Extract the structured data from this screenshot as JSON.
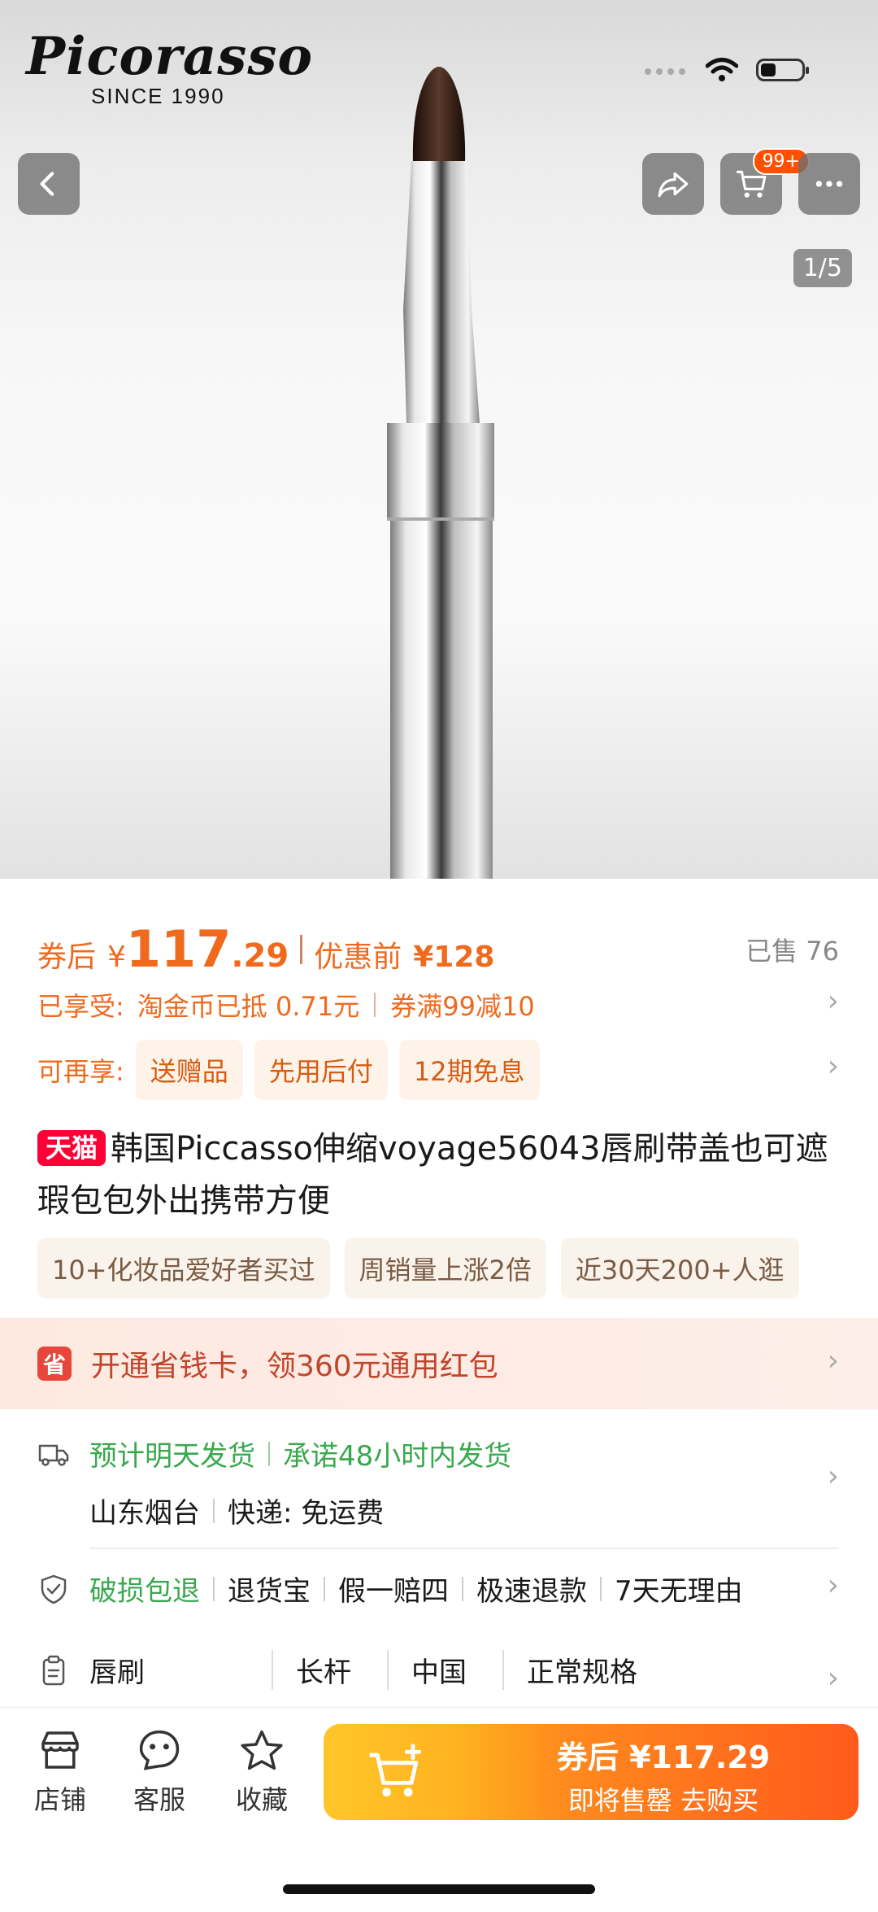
{
  "brand": {
    "logo_text": "Picorasso",
    "since": "SINCE 1990"
  },
  "nav": {
    "cart_badge": "99+",
    "image_counter": "1/5"
  },
  "price": {
    "coupon_label": "券后",
    "currency": "¥",
    "coupon_price_int": "117",
    "coupon_price_dec": ".29",
    "original_label": "优惠前",
    "original_price": "¥128",
    "sold": "已售 76"
  },
  "discounts": {
    "label": "已享受:",
    "item1": "淘金币已抵 0.71元",
    "item2": "券满99减10"
  },
  "extras": {
    "label": "可再享:",
    "chips": [
      "送赠品",
      "先用后付",
      "12期免息"
    ]
  },
  "product": {
    "badge": "天猫",
    "title": "韩国Piccasso伸缩voyage56043唇刷带盖也可遮瑕包包外出携带方便"
  },
  "tags": [
    "10+化妆品爱好者买过",
    "周销量上涨2倍",
    "近30天200+人逛"
  ],
  "banner": {
    "icon": "省",
    "text": "开通省钱卡，领360元通用红包"
  },
  "shipping": {
    "line1a": "预计明天发货",
    "line1b": "承诺48小时内发货",
    "origin": "山东烟台",
    "courier": "快递: 免运费"
  },
  "guarantee": {
    "first": "破损包退",
    "items": [
      "退货宝",
      "假一赔四",
      "极速退款",
      "7天无理由"
    ]
  },
  "specs": [
    "唇刷",
    "长杆",
    "中国",
    "正常规格"
  ],
  "bottom_bar": {
    "shop": "店铺",
    "service": "客服",
    "favorite": "收藏",
    "buy_line1": "券后 ¥117.29",
    "buy_line2": "即将售罄 去购买"
  },
  "colors": {
    "accent": "#f06a1e",
    "green": "#3aa84e",
    "tmall_red": "#ff0036"
  }
}
